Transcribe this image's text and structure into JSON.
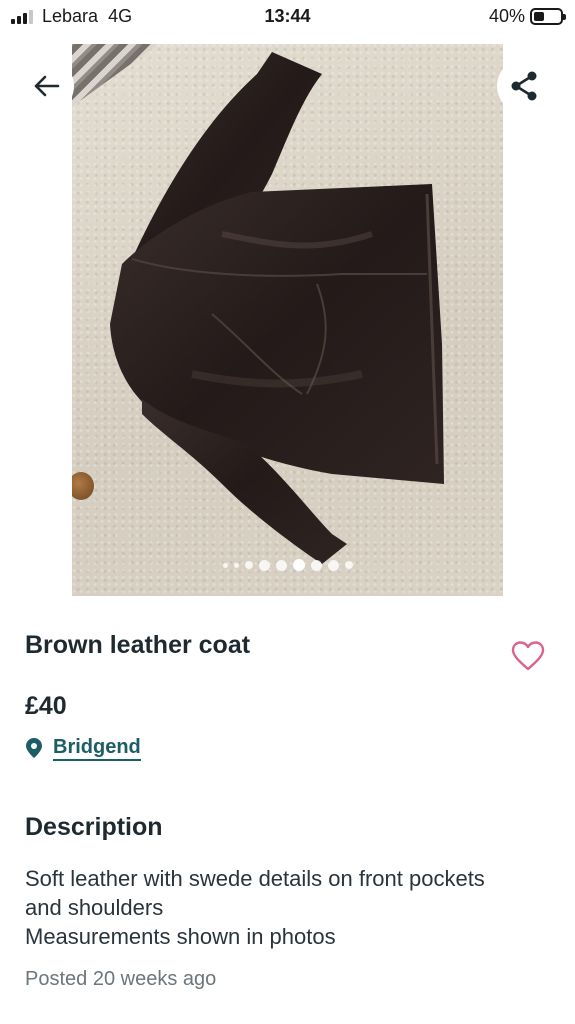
{
  "status_bar": {
    "carrier": "Lebara",
    "network": "4G",
    "time": "13:44",
    "battery_percent": "40%",
    "battery_level": 0.4
  },
  "listing": {
    "photo_count": 9,
    "active_photo_index": 5,
    "title": "Brown leather coat",
    "price": "£40",
    "location": "Bridgend",
    "description_heading": "Description",
    "description_lines": [
      "Soft leather with swede details on front pockets",
      "and shoulders",
      "Measurements shown in photos"
    ],
    "posted": "Posted 20 weeks ago"
  },
  "icons": {
    "back": "arrow-left-icon",
    "share": "share-icon",
    "favorite": "heart-icon",
    "location": "map-pin-icon"
  },
  "colors": {
    "accent_link": "#1d5d66",
    "heart": "#d9658c",
    "text_primary": "#1f2a30",
    "text_muted": "#6c767b"
  }
}
